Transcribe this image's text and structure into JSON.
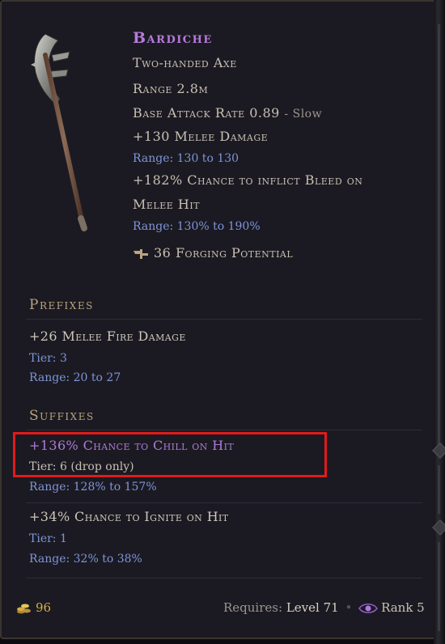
{
  "item": {
    "name": "Bardiche",
    "type": "Two-handed Axe",
    "range": "Range 2.8m",
    "attack_rate": "Base Attack Rate 0.89",
    "attack_speed": "- Slow",
    "implicits": [
      {
        "text": "+130 Melee Damage",
        "range": "Range: 130 to 130"
      },
      {
        "text_line1": "+182% Chance to inflict Bleed on",
        "text_line2": "Melee Hit",
        "range": "Range: 130% to 190%"
      }
    ],
    "forging_potential": "36 Forging Potential"
  },
  "prefixes": {
    "header": "Prefixes",
    "items": [
      {
        "text": "+26 Melee Fire Damage",
        "tier": "Tier: 3",
        "range": "Range: 20 to 27"
      }
    ]
  },
  "suffixes": {
    "header": "Suffixes",
    "items": [
      {
        "text": "+136% Chance to Chill on Hit",
        "tier": "Tier: 6 (drop only)",
        "range": "Range: 128% to 157%",
        "highlighted": true
      },
      {
        "text": "+34% Chance to Ignite on Hit",
        "tier": "Tier: 1",
        "range": "Range: 32% to 38%"
      }
    ]
  },
  "footer": {
    "gold": "96",
    "requires_label": "Requires:",
    "requires_value": "Level 71",
    "rank": "Rank 5"
  },
  "colors": {
    "title": "#b57bdc",
    "range_blue": "#7e95d8",
    "section_gold": "#b9a57e",
    "highlight_red": "#e01b1b",
    "chill_purple": "#b07ad8"
  },
  "icons": [
    "axe-weapon-icon",
    "forging-hammer-icon",
    "gold-coins-icon",
    "rank-eye-icon"
  ]
}
